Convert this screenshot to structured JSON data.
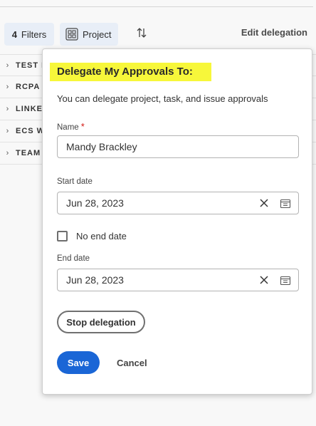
{
  "toolbar": {
    "filters_count": "4",
    "filters_label": "Filters",
    "project_label": "Project",
    "edit_delegation_label": "Edit delegation"
  },
  "list": {
    "items": [
      {
        "label": "TEST I"
      },
      {
        "label": "RCPA"
      },
      {
        "label": "LINKE"
      },
      {
        "label": "ECS W"
      },
      {
        "label": "TEAM"
      }
    ]
  },
  "popover": {
    "title": "Delegate My Approvals To:",
    "subtitle": "You can delegate project, task, and issue approvals",
    "name_label": "Name",
    "required_mark": "*",
    "name_value": "Mandy Brackley",
    "start_date_label": "Start date",
    "start_date_value": "Jun 28, 2023",
    "no_end_date_label": "No end date",
    "no_end_date_checked": false,
    "end_date_label": "End date",
    "end_date_value": "Jun 28, 2023",
    "stop_delegation_label": "Stop delegation",
    "save_label": "Save",
    "cancel_label": "Cancel"
  },
  "colors": {
    "highlight": "#f7f73a",
    "primary": "#1a66d6",
    "required": "#d31510",
    "chip_bg": "#e8eef7"
  },
  "icons": {
    "project": "grid-layout-icon",
    "sort": "sort-arrows-icon",
    "clear": "close-icon",
    "calendar": "calendar-icon",
    "row_expand": "chevron-right-icon"
  }
}
